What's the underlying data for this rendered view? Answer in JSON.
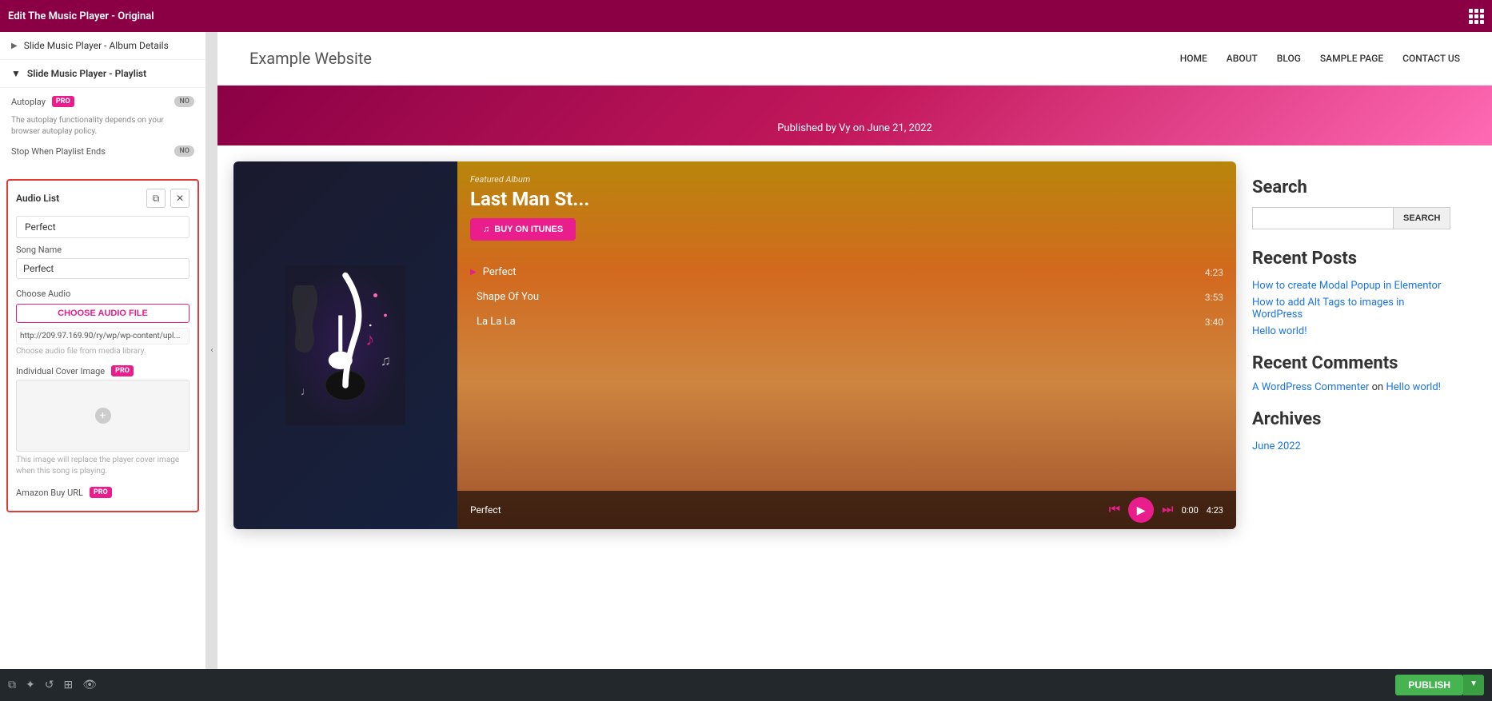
{
  "topBar": {
    "title": "Edit The Music Player - Original",
    "gridIcon": true
  },
  "sidebar": {
    "items": [
      {
        "label": "Slide Music Player - Album Details",
        "expanded": false
      },
      {
        "label": "Slide Music Player - Playlist",
        "expanded": true
      }
    ],
    "autoplay": {
      "label": "Autoplay",
      "badge": "PRO",
      "toggle": "NO"
    },
    "autoplayDesc": "The autoplay functionality depends on your browser autoplay policy.",
    "stopWhenPlaylist": {
      "label": "Stop When Playlist Ends",
      "toggle": "NO"
    },
    "audioList": {
      "title": "Audio List",
      "copyIcon": "⧉",
      "closeIcon": "✕",
      "itemLabel": "Perfect",
      "songNameLabel": "Song Name",
      "songNameValue": "Perfect",
      "chooseAudioLabel": "Choose Audio",
      "chooseAudioBtn": "CHOOSE AUDIO FILE",
      "audioUrl": "http://209.97.169.90/ry/wp/wp-content/upl...",
      "audioHint": "Choose audio file from media library.",
      "coverImageLabel": "Individual Cover Image",
      "coverImageBadge": "PRO",
      "coverHint": "This image will replace the player cover image when this song is playing.",
      "amazonLabel": "Amazon Buy URL",
      "amazonBadge": "PRO"
    }
  },
  "bottomBar": {
    "publishLabel": "PUBLISH"
  },
  "website": {
    "title": "Example Website",
    "nav": [
      {
        "label": "HOME"
      },
      {
        "label": "ABOUT"
      },
      {
        "label": "BLOG"
      },
      {
        "label": "SAMPLE PAGE"
      },
      {
        "label": "CONTACT US"
      }
    ],
    "publishedBy": "Published by Vy on June 21, 2022"
  },
  "musicPlayer": {
    "featuredAlbum": "Featured Album",
    "albumTitle": "Last Man St...",
    "buyItunesBtn": "BUY ON ITUNES",
    "playlist": [
      {
        "name": "Perfect",
        "duration": "4:23",
        "active": true
      },
      {
        "name": "Shape Of You",
        "duration": "3:53",
        "active": false
      },
      {
        "name": "La La La",
        "duration": "3:40",
        "active": false
      }
    ],
    "controls": {
      "songName": "Perfect",
      "currentTime": "0:00",
      "totalTime": "4:23"
    }
  },
  "rightSidebar": {
    "searchTitle": "Search",
    "searchBtn": "SEARCH",
    "searchPlaceholder": "",
    "recentPostsTitle": "Recent Posts",
    "recentPosts": [
      "How to create Modal Popup in Elementor",
      "How to add Alt Tags to images in WordPress",
      "Hello world!"
    ],
    "recentCommentsTitle": "Recent Comments",
    "commenterName": "A WordPress Commenter",
    "commenterOn": "on",
    "commenterPost": "Hello world!",
    "archivesTitle": "Archives",
    "archiveLink": "June 2022"
  }
}
